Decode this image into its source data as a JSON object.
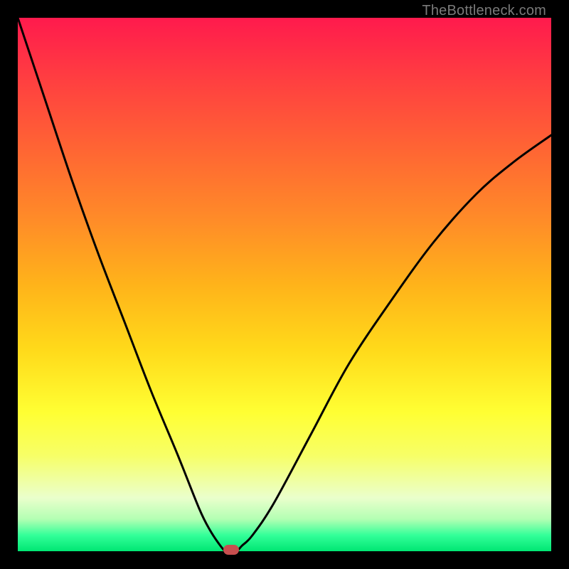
{
  "watermark": {
    "text": "TheBottleneck.com"
  },
  "chart_data": {
    "type": "line",
    "title": "",
    "xlabel": "",
    "ylabel": "",
    "xlim": [
      0,
      100
    ],
    "ylim": [
      0,
      100
    ],
    "grid": false,
    "legend": false,
    "series": [
      {
        "name": "bottleneck-curve",
        "x": [
          0,
          5,
          10,
          15,
          20,
          25,
          30,
          34,
          36,
          38,
          39,
          40,
          41,
          42,
          44,
          48,
          55,
          62,
          70,
          78,
          86,
          93,
          100
        ],
        "values": [
          100,
          85,
          70,
          56,
          43,
          30,
          18,
          8,
          4,
          1,
          0,
          0,
          0,
          1,
          3,
          9,
          22,
          35,
          47,
          58,
          67,
          73,
          78
        ]
      }
    ],
    "marker": {
      "x": 40,
      "y": 0,
      "color": "#c74f4f"
    },
    "background_gradient": {
      "stops": [
        {
          "pos": 0.0,
          "color": "#ff1a4d"
        },
        {
          "pos": 0.25,
          "color": "#ff6633"
        },
        {
          "pos": 0.5,
          "color": "#ffb31a"
        },
        {
          "pos": 0.74,
          "color": "#ffff33"
        },
        {
          "pos": 0.9,
          "color": "#eaffcc"
        },
        {
          "pos": 1.0,
          "color": "#00e673"
        }
      ]
    }
  }
}
